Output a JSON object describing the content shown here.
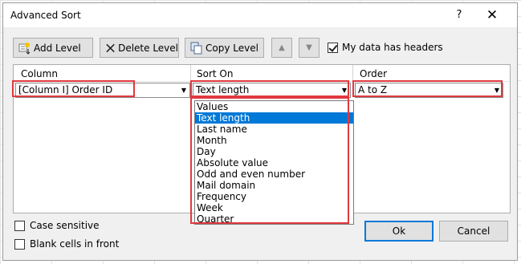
{
  "window": {
    "title": "Advanced Sort",
    "help": "?",
    "close": "✕"
  },
  "toolbar": {
    "add_level": "Add Level",
    "delete_level": "Delete Level",
    "copy_level": "Copy Level",
    "move_up_icon": "up-arrow",
    "move_down_icon": "down-arrow",
    "headers_label": "My data has headers",
    "headers_checked": true
  },
  "grid": {
    "headers": [
      "Column",
      "Sort On",
      "Order"
    ],
    "row": {
      "column": "[Column I] Order ID",
      "sort_on": "Text length",
      "order": "A to Z"
    }
  },
  "sort_on_options": [
    "Values",
    "Text length",
    "Last name",
    "Month",
    "Day",
    "Absolute value",
    "Odd and even number",
    "Mail domain",
    "Frequency",
    "Week",
    "Quarter"
  ],
  "selected_option": "Text length",
  "options": {
    "case_sensitive": "Case sensitive",
    "blank_cells": "Blank cells in front"
  },
  "buttons": {
    "ok": "Ok",
    "cancel": "Cancel"
  },
  "colors": {
    "highlight": "#e0393e",
    "selection": "#0078d7"
  }
}
